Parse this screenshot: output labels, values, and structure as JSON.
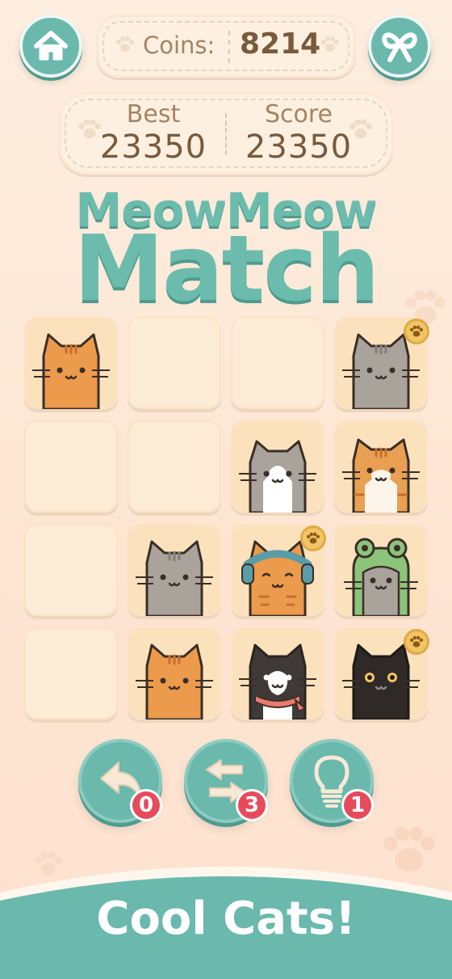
{
  "header": {
    "home_icon": "home-icon",
    "bow_icon": "bow-icon",
    "coins_label": "Coins:",
    "coins_value": "8214",
    "best_label": "Best",
    "best_value": "23350",
    "score_label": "Score",
    "score_value": "23350"
  },
  "title": {
    "line1": "MeowMeow",
    "line2": "Match"
  },
  "board": {
    "rows": [
      [
        "orange-cat",
        "empty",
        "empty",
        "gray-cat"
      ],
      [
        "empty",
        "empty",
        "gray-white-cat",
        "orange-white-cat"
      ],
      [
        "empty",
        "gray-cat",
        "headphones-cat",
        "frog-hat-cat"
      ],
      [
        "empty",
        "orange-cat",
        "tuxedo-scarf-cat",
        "black-cat"
      ]
    ],
    "paw_badges": [
      "0-3",
      "2-2",
      "3-3"
    ]
  },
  "actions": {
    "undo": {
      "icon": "undo-arrow-icon",
      "count": "0"
    },
    "shuffle": {
      "icon": "shuffle-icon",
      "count": "3"
    },
    "hint": {
      "icon": "lightbulb-icon",
      "count": "1"
    }
  },
  "banner": {
    "text": "Cool Cats!"
  },
  "colors": {
    "teal": "#6ab9ac",
    "background": "#fde9d8",
    "tile": "#fcebd5",
    "badge_red": "#e64b5b",
    "text_brown": "#7a5a3c"
  }
}
